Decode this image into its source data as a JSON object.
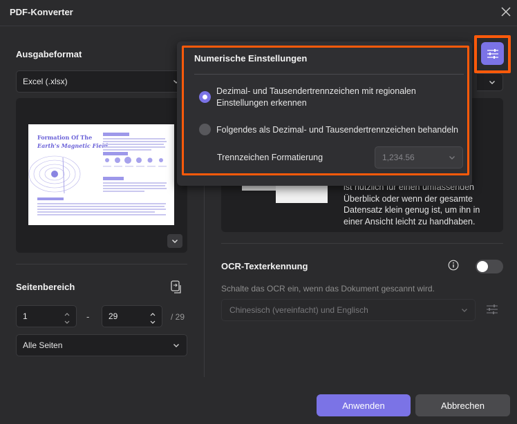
{
  "window": {
    "title": "PDF-Konverter"
  },
  "output": {
    "label": "Ausgabeformat",
    "format_value": "Excel (.xlsx)"
  },
  "preview": {
    "title_line1": "Formation Of The",
    "title_line2": "Earth's Magnetic Field"
  },
  "page_range": {
    "label": "Seitenbereich",
    "from": "1",
    "separator": "-",
    "to": "29",
    "total": "/ 29",
    "scope_value": "Alle Seiten"
  },
  "info": {
    "text": "ist nützlich für einen umfassenden Überblick oder wenn der gesamte Datensatz klein genug ist, um ihn in einer Ansicht leicht zu handhaben."
  },
  "ocr": {
    "label": "OCR-Texterkennung",
    "description": "Schalte das OCR ein, wenn das Dokument gescannt wird.",
    "language_value": "Chinesisch (vereinfacht) und Englisch",
    "enabled": false
  },
  "numeric_settings": {
    "title": "Numerische Einstellungen",
    "option1": "Dezimal- und Tausendertrennzeichen mit regionalen Einstellungen erkennen",
    "option2": "Folgendes als Dezimal- und Tausendertrennzeichen behandeln",
    "format_label": "Trennzeichen Formatierung",
    "format_value": "1,234.56",
    "selected_option": 1
  },
  "buttons": {
    "apply": "Anwenden",
    "cancel": "Abbrechen"
  },
  "colors": {
    "accent": "#7b73e6",
    "highlight": "#ff5a0a",
    "background": "#2b2b2d"
  }
}
